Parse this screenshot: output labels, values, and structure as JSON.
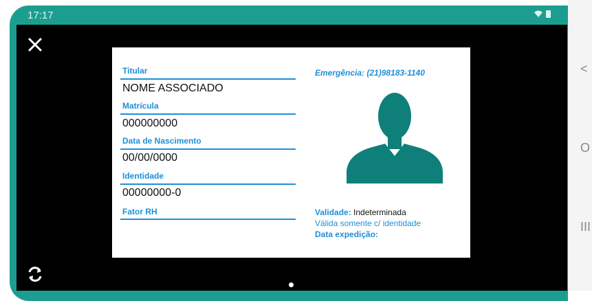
{
  "status": {
    "time": "17:17",
    "wifi_icon": "wifi-icon",
    "battery_icon": "battery-icon"
  },
  "viewer": {
    "close_icon": "close-icon",
    "rotate_icon": "rotate-icon",
    "page_indicator": "dot"
  },
  "card": {
    "fields": [
      {
        "label": "Titular",
        "value": "NOME ASSOCIADO"
      },
      {
        "label": "Matrícula",
        "value": "000000000"
      },
      {
        "label": "Data de Nascimento",
        "value": "00/00/0000"
      },
      {
        "label": "Identidade",
        "value": "00000000-0"
      },
      {
        "label": "Fator RH",
        "value": ""
      }
    ],
    "emergency": "Emergência: (21)98183-1140",
    "validity_label": "Validade:",
    "validity_value": "Indeterminada",
    "validity_note": "Válida somente c/ identidade",
    "issue_label": "Data expedição:",
    "avatar_icon": "person-silhouette-icon",
    "colors": {
      "accent": "#1f8fd6",
      "avatar": "#0f7f7a"
    }
  },
  "navigation": {
    "back_label": "<",
    "home_label": "O",
    "recents_label": "III"
  }
}
